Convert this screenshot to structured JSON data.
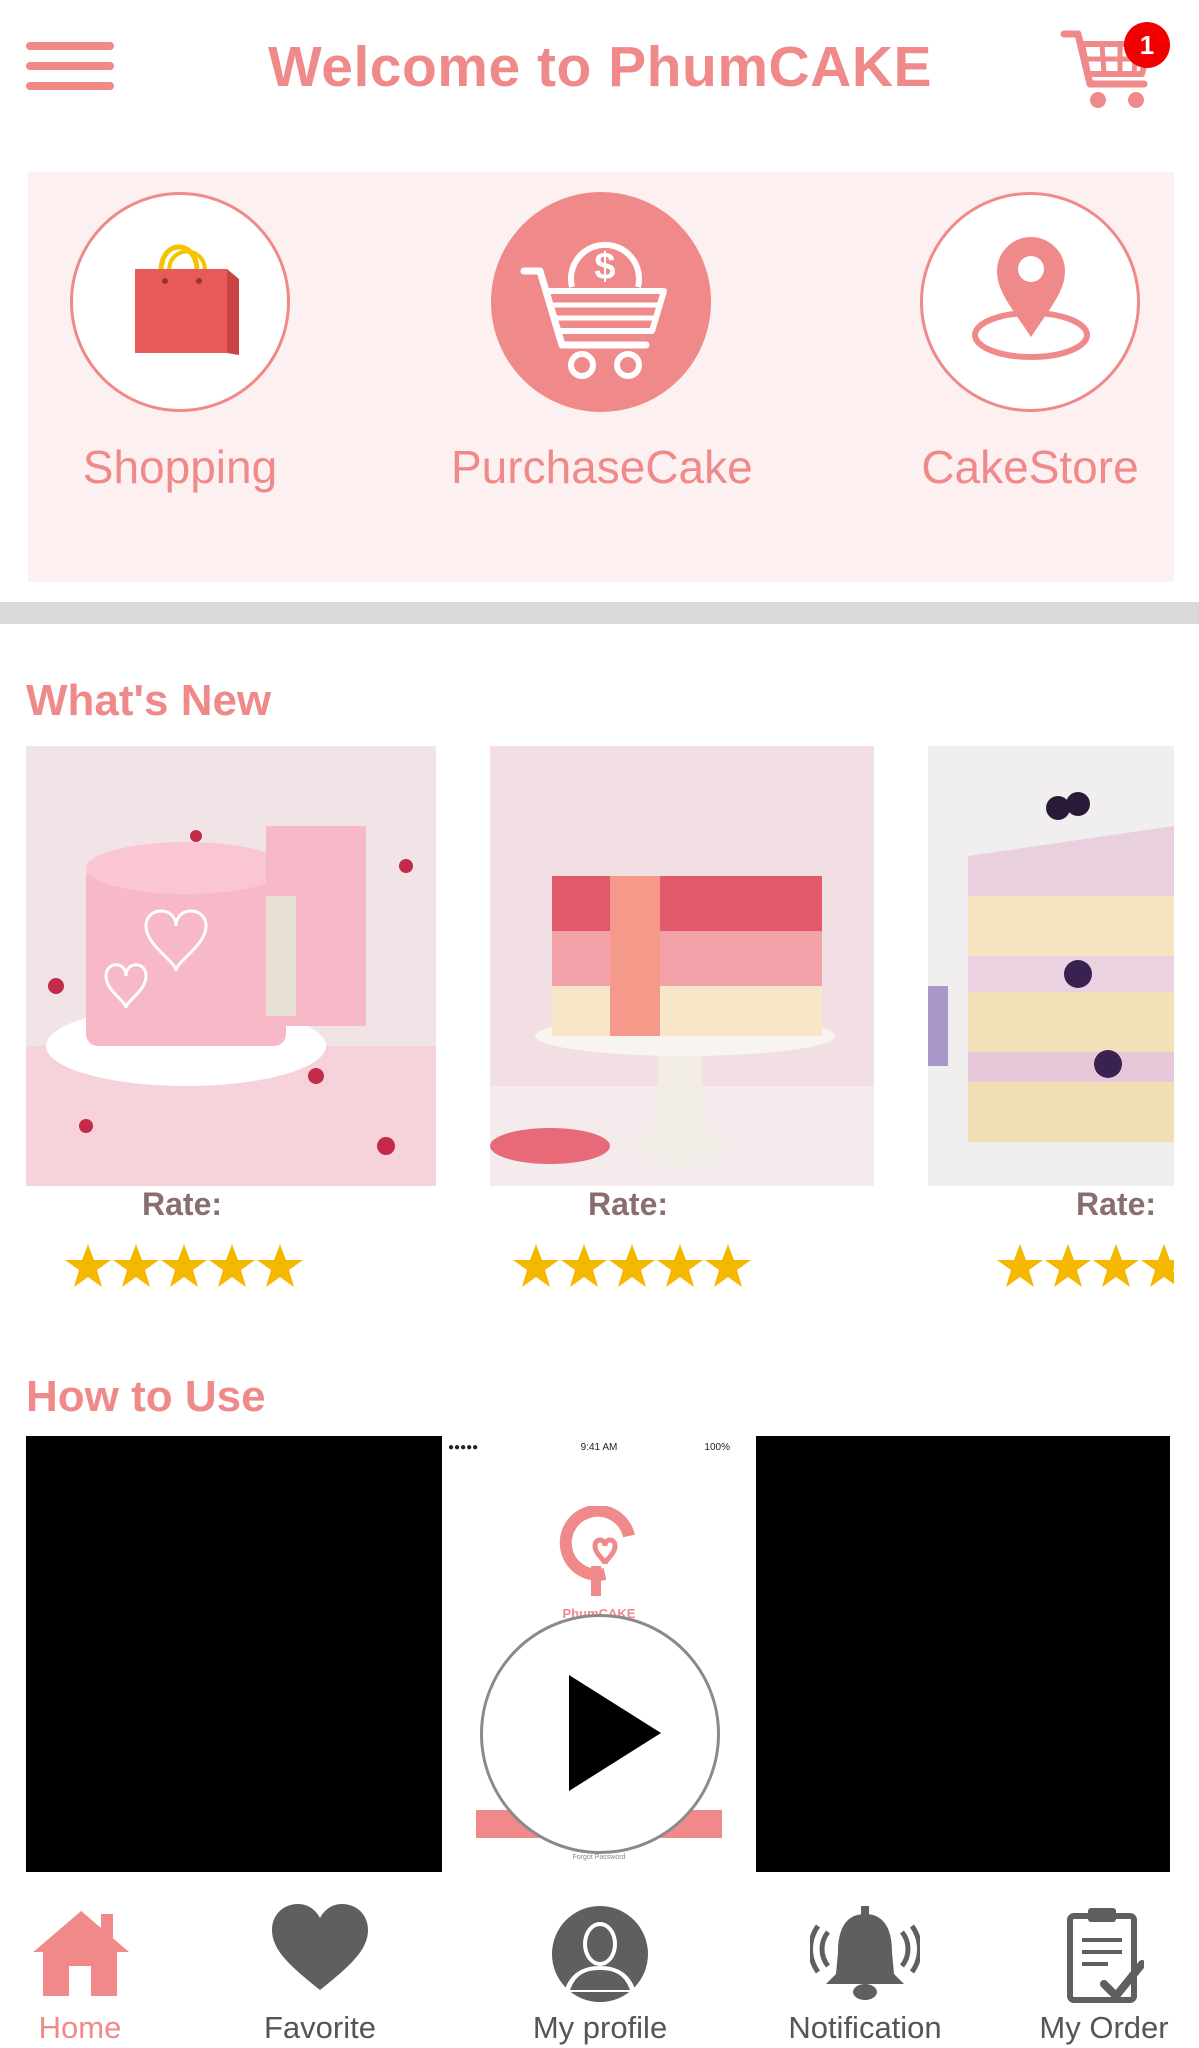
{
  "header": {
    "title": "Welcome to PhumCAKE",
    "cart_count": "1"
  },
  "quick_actions": [
    {
      "label": "Shopping",
      "icon": "shopping-bag-icon"
    },
    {
      "label": "PurchaseCake",
      "icon": "cart-dollar-icon"
    },
    {
      "label": "CakeStore",
      "icon": "location-pin-icon"
    }
  ],
  "whats_new": {
    "title": "What's New",
    "items": [
      {
        "rate_label": "Rate:",
        "rating": 5,
        "image": "pink heart cake"
      },
      {
        "rate_label": "Rate:",
        "rating": 5,
        "image": "ombre rose cake"
      },
      {
        "rate_label": "Rate:",
        "rating": 4,
        "image": "berry layer cake"
      }
    ]
  },
  "how_to_use": {
    "title": "How to Use",
    "video": {
      "status_time": "9:41 AM",
      "status_battery": "100%",
      "app_name": "PhumCAKE",
      "link_text": "Forgot Password"
    }
  },
  "bottom_nav": [
    {
      "label": "Home",
      "icon": "home-icon",
      "active": true
    },
    {
      "label": "Favorite",
      "icon": "heart-icon",
      "active": false
    },
    {
      "label": "My profile",
      "icon": "profile-icon",
      "active": false
    },
    {
      "label": "Notification",
      "icon": "bell-icon",
      "active": false
    },
    {
      "label": "My Order",
      "icon": "clipboard-check-icon",
      "active": false
    }
  ],
  "colors": {
    "accent": "#f08a8a",
    "panel": "#fdf0f0",
    "badge": "#f00000",
    "star": "#f5b800",
    "nav_icon": "#5f5f5f"
  }
}
